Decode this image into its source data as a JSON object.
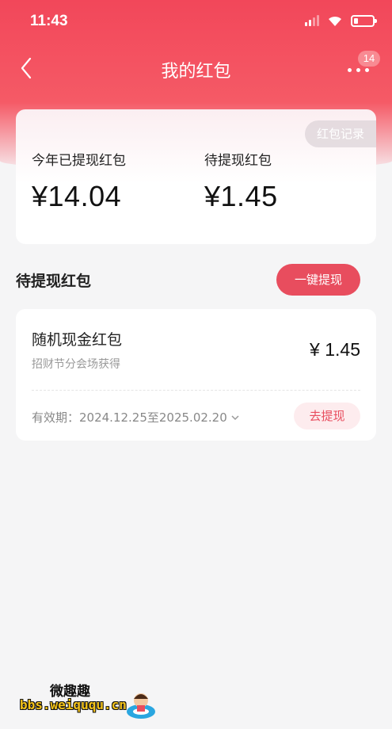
{
  "status_bar": {
    "time": "11:43"
  },
  "nav": {
    "title": "我的红包",
    "badge_count": "14"
  },
  "summary": {
    "record_label": "红包记录",
    "withdrawn_label": "今年已提现红包",
    "withdrawn_value": "¥14.04",
    "pending_label": "待提现红包",
    "pending_value": "¥1.45"
  },
  "pending_section": {
    "title": "待提现红包",
    "withdraw_all_label": "一键提现",
    "items": [
      {
        "name": "随机现金红包",
        "source": "招财节分会场获得",
        "amount": "¥ 1.45",
        "validity": "有效期：2024.12.25至2025.02.20",
        "action_label": "去提现"
      }
    ]
  },
  "watermark": {
    "title": "微趣趣",
    "url": "bbs.weiququ.cn"
  },
  "colors": {
    "brand_red": "#e84d5e",
    "header_red": "#f2475a",
    "background": "#f5f5f6"
  }
}
